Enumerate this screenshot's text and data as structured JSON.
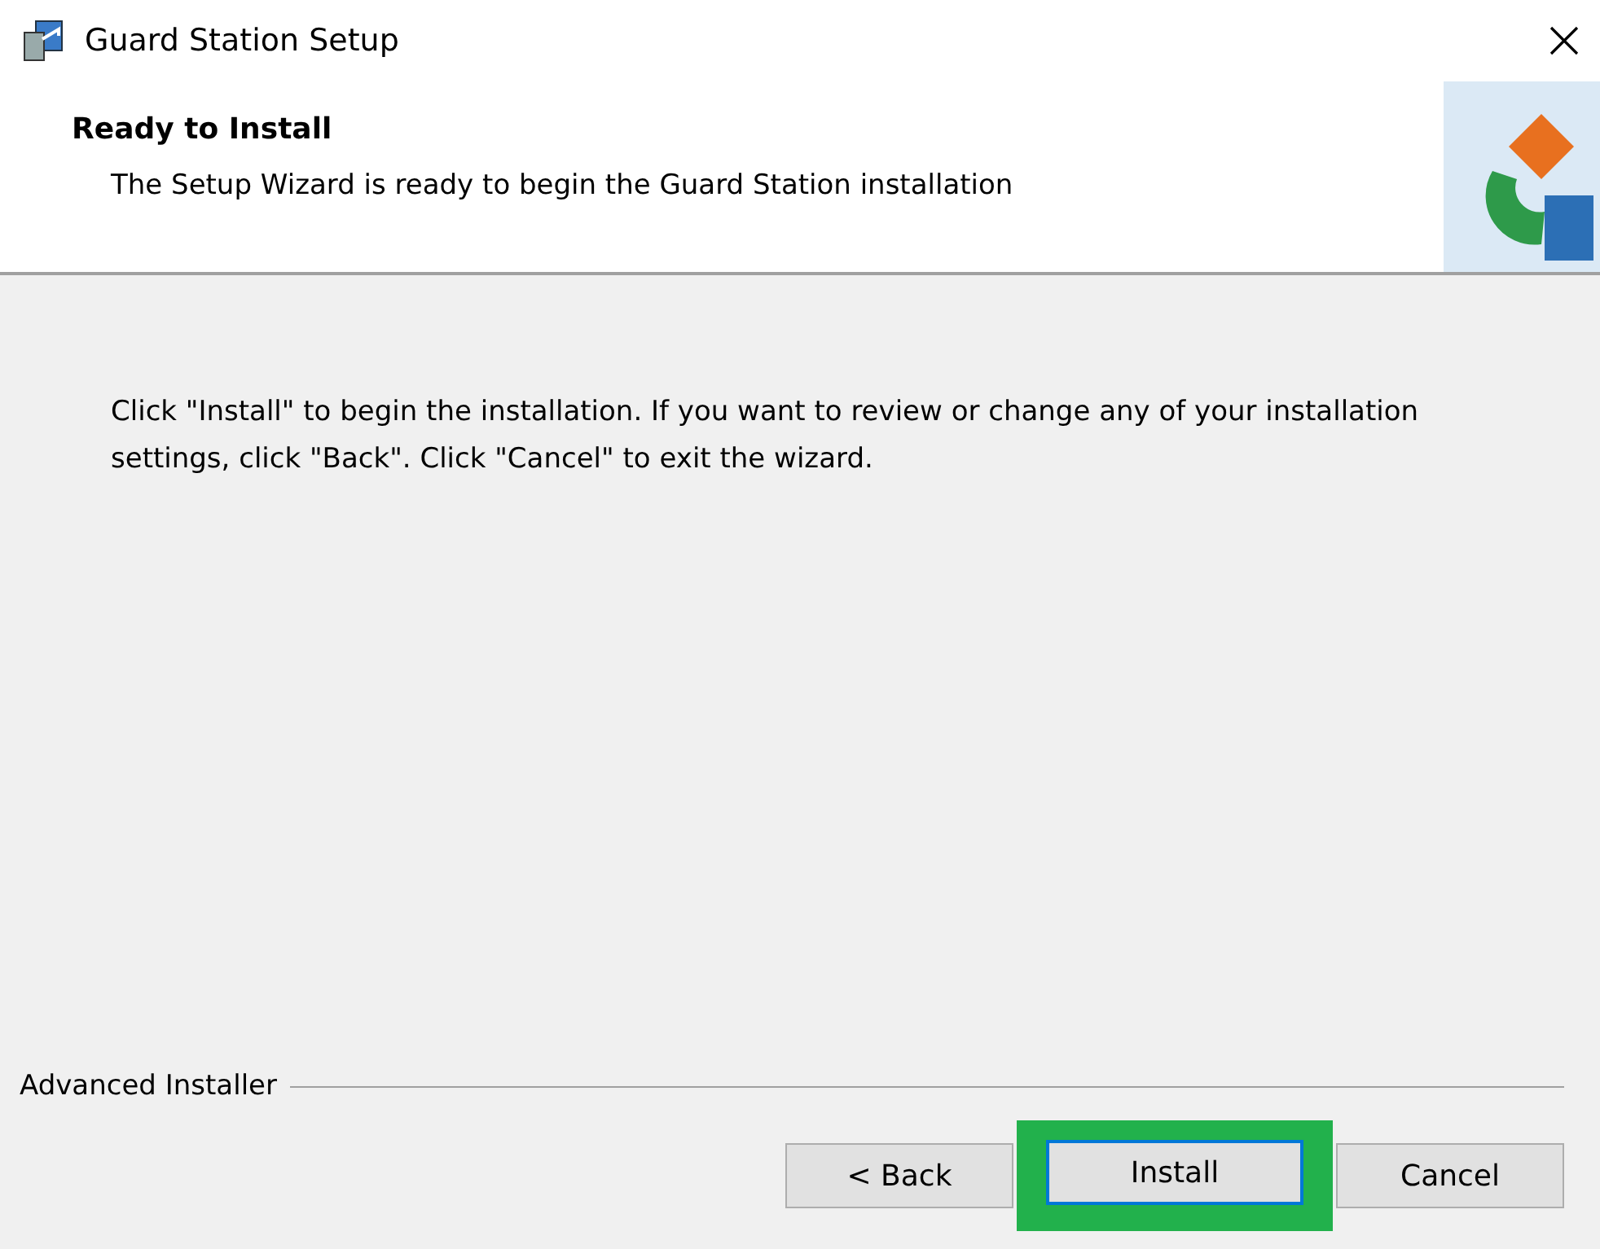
{
  "window": {
    "title": "Guard Station Setup"
  },
  "header": {
    "title": "Ready to Install",
    "subtitle": "The Setup Wizard is ready to begin the Guard Station installation"
  },
  "body": {
    "text": "Click \"Install\" to begin the installation.  If you want to review or change any of your installation settings, click \"Back\".  Click \"Cancel\" to exit the wizard."
  },
  "footer": {
    "brand": "Advanced Installer"
  },
  "buttons": [
    {
      "label": "< Back",
      "focused": false,
      "highlighted": false
    },
    {
      "label": "Install",
      "focused": true,
      "highlighted": true
    },
    {
      "label": "Cancel",
      "focused": false,
      "highlighted": false
    }
  ]
}
